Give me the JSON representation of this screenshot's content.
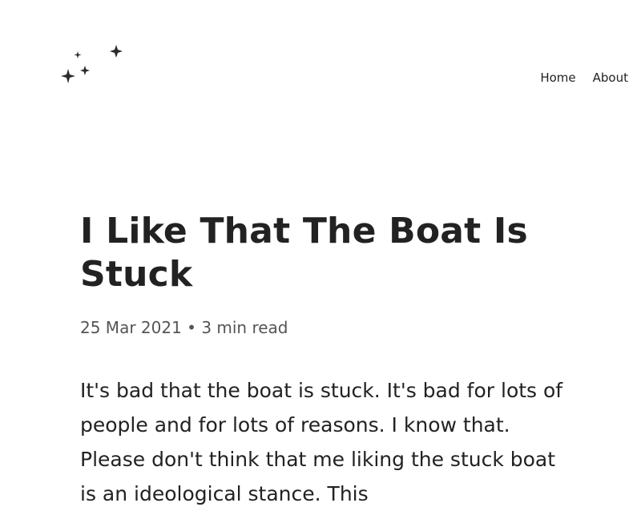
{
  "header": {
    "logo_icon": "moon-and-stars-icon",
    "nav": [
      {
        "label": "Home"
      },
      {
        "label": "About"
      }
    ]
  },
  "post": {
    "title": "I Like That The Boat Is Stuck",
    "date": "25 Mar 2021",
    "separator": "•",
    "read_time": "3 min read",
    "intro": "It's bad that the boat is stuck. It's bad for lots of people and for lots of reasons. I know that. Please don't think that me liking the stuck boat is an ideological stance. This"
  },
  "colors": {
    "text": "#222222",
    "meta": "#555555",
    "background": "#ffffff"
  }
}
